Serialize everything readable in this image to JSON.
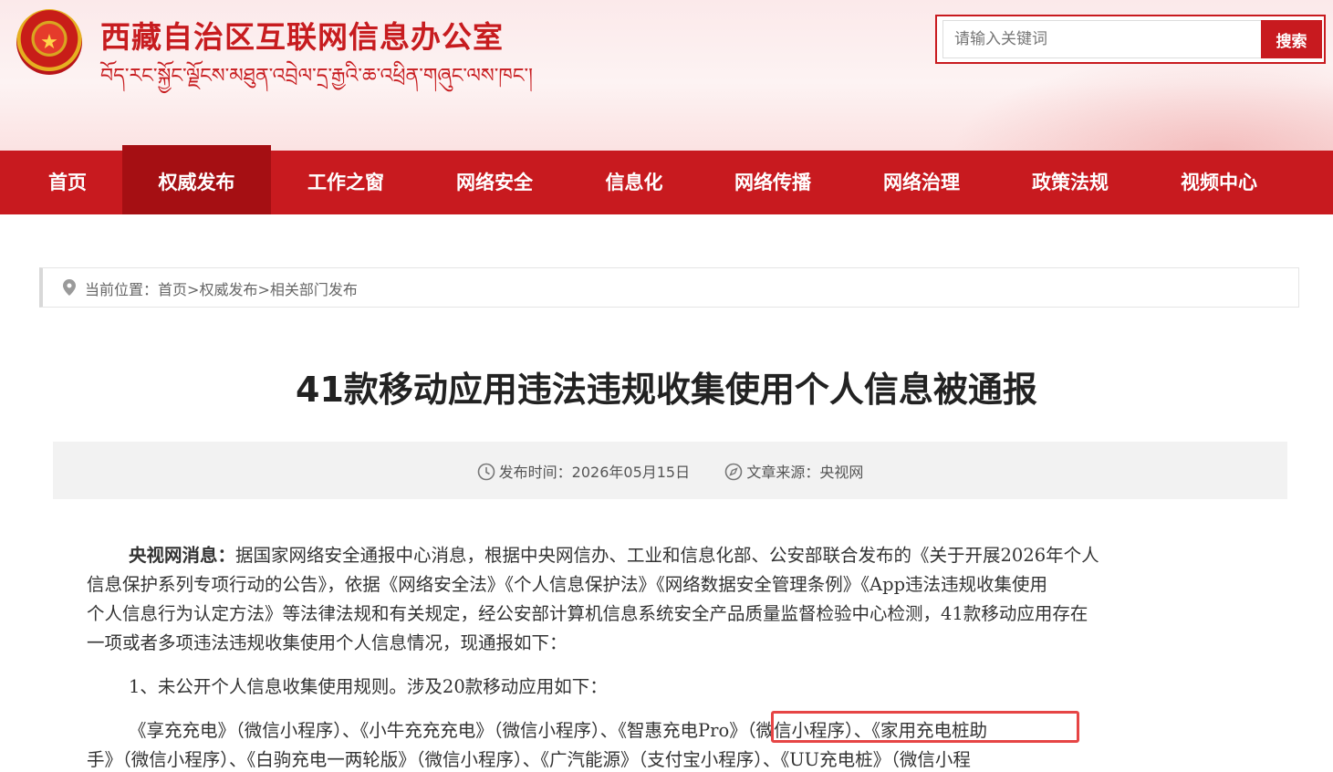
{
  "header": {
    "site_title": "西藏自治区互联网信息办公室",
    "site_title_tibetan": "བོད་རང་སྐྱོང་ལྗོངས་མཐུན་འབྲེལ་དྲ་རྒྱའི་ཆ་འཕྲིན་གཞུང་ལས་ཁང་།",
    "emblem_glyph": "★",
    "search_placeholder": "请输入关键词",
    "search_button": "搜索"
  },
  "nav": {
    "items": [
      {
        "label": "首页",
        "active": false
      },
      {
        "label": "权威发布",
        "active": true
      },
      {
        "label": "工作之窗",
        "active": false
      },
      {
        "label": "网络安全",
        "active": false
      },
      {
        "label": "信息化",
        "active": false
      },
      {
        "label": "网络传播",
        "active": false
      },
      {
        "label": "网络治理",
        "active": false
      },
      {
        "label": "政策法规",
        "active": false
      },
      {
        "label": "视频中心",
        "active": false
      }
    ]
  },
  "breadcrumb": {
    "prefix": "当前位置：",
    "home": "首页",
    "section": "权威发布",
    "subsection": "相关部门发布",
    "separator": ">"
  },
  "article": {
    "title": "41款移动应用违法违规收集使用个人信息被通报",
    "publish_label": "发布时间：",
    "publish_date": "2026年05月15日",
    "source_label": "文章来源：",
    "source": "央视网",
    "lead_bold": "央视网消息：",
    "para1_line1": "据国家网络安全通报中心消息，根据中央网信办、工业和信息化部、公安部联合发布的《关于开展2026年个人",
    "para1_line2": "信息保护系列专项行动的公告》，依据《网络安全法》《个人信息保护法》《网络数据安全管理条例》《App违法违规收集使用",
    "para1_line3": "个人信息行为认定方法》等法律法规和有关规定，经公安部计算机信息系统安全产品质量监督检验中心检测，41款移动应用存在",
    "para1_line4": "一项或者多项违法违规收集使用个人信息情况，现通报如下：",
    "section1_heading": "1、未公开个人信息收集使用规则。涉及20款移动应用如下：",
    "list_line1_a": "《享充充电》（微信小程序）、《小牛充充充电》（微信小程序）、",
    "list_line1_highlight": "《智惠充电Pro》（微信小程序）",
    "list_line1_b": "、《家用充电桩助",
    "list_line2": "手》（微信小程序）、《白驹充电一两轮版》（微信小程序）、《广汽能源》（支付宝小程序）、《UU充电桩》（微信小程"
  },
  "colors": {
    "brand_red": "#c81a1f",
    "active_nav": "#a50f13",
    "highlight_box": "#e64545"
  }
}
